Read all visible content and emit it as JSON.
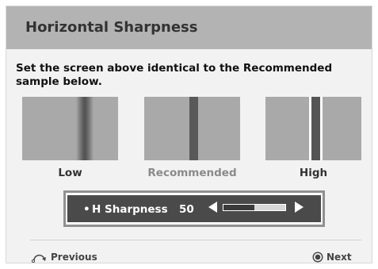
{
  "header": {
    "title": "Horizontal Sharpness"
  },
  "instruction": "Set the screen above identical to the Recommended sample  below.",
  "samples": [
    {
      "label": "Low"
    },
    {
      "label": "Recommended"
    },
    {
      "label": "High"
    }
  ],
  "control": {
    "bullet": "•",
    "label": "H Sharpness",
    "value": "50",
    "level_percent": 50
  },
  "footer": {
    "previous_label": "Previous",
    "next_label": "Next"
  },
  "colors": {
    "header_bg": "#b3b3b3",
    "panel_bg": "#f2f2f2",
    "control_bg": "#4a4a4a"
  }
}
